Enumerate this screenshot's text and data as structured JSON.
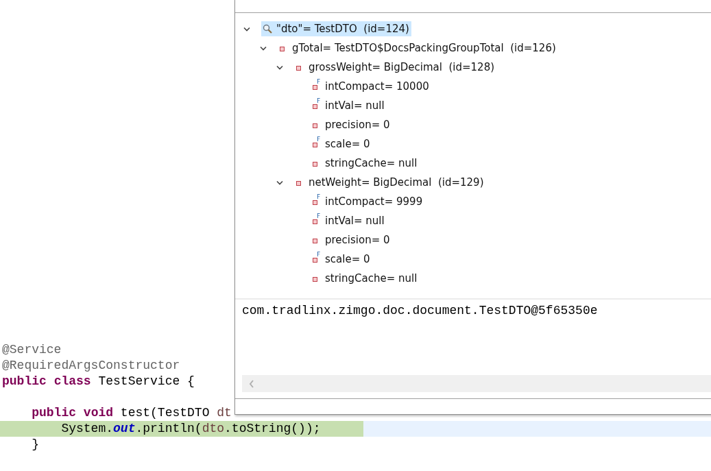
{
  "editor": {
    "lines": [
      {
        "current": false,
        "tokens": [
          {
            "kind": "annotation",
            "text": "@Service"
          }
        ]
      },
      {
        "current": false,
        "tokens": [
          {
            "kind": "annotation",
            "text": "@RequiredArgsConstructor"
          }
        ]
      },
      {
        "current": false,
        "tokens": [
          {
            "kind": "keyword",
            "text": "public "
          },
          {
            "kind": "keyword",
            "text": "class"
          },
          {
            "kind": "plain",
            "text": " TestService {"
          }
        ]
      },
      {
        "current": false
      },
      {
        "current": false,
        "tokens": [
          {
            "kind": "keyword",
            "text": "    public "
          },
          {
            "kind": "keyword",
            "text": "void"
          },
          {
            "kind": "plain",
            "text": " test(TestDTO "
          },
          {
            "kind": "param",
            "text": "dt"
          }
        ]
      },
      {
        "current": true,
        "tokens": [
          {
            "kind": "plain",
            "text": "        System."
          },
          {
            "kind": "static",
            "text": "out"
          },
          {
            "kind": "plain",
            "text": ".println("
          },
          {
            "kind": "param",
            "text": "dto"
          },
          {
            "kind": "plain",
            "text": ".toString());"
          }
        ]
      },
      {
        "current": false,
        "tokens": [
          {
            "kind": "plain",
            "text": "    }"
          }
        ]
      }
    ]
  },
  "inspector": {
    "tree": [
      {
        "kind": "expression",
        "text": "\"dto\"= TestDTO  (id=124)",
        "selected": true,
        "expanded": true,
        "children": [
          {
            "kind": "field",
            "text": "gTotal= TestDTO$DocsPackingGroupTotal  (id=126)",
            "selected": false,
            "expanded": true,
            "children": [
              {
                "kind": "field",
                "text": "grossWeight= BigDecimal  (id=128)",
                "selected": false,
                "expanded": true,
                "children": [
                  {
                    "kind": "field",
                    "modifier": "F",
                    "text": "intCompact= 10000",
                    "selected": false
                  },
                  {
                    "kind": "field",
                    "modifier": "F",
                    "text": "intVal= null",
                    "selected": false
                  },
                  {
                    "kind": "field",
                    "text": "precision= 0",
                    "selected": false
                  },
                  {
                    "kind": "field",
                    "modifier": "F",
                    "text": "scale= 0",
                    "selected": false
                  },
                  {
                    "kind": "field",
                    "text": "stringCache= null",
                    "selected": false
                  }
                ]
              },
              {
                "kind": "field",
                "text": "netWeight= BigDecimal  (id=129)",
                "selected": false,
                "expanded": true,
                "children": [
                  {
                    "kind": "field",
                    "modifier": "F",
                    "text": "intCompact= 9999",
                    "selected": false
                  },
                  {
                    "kind": "field",
                    "modifier": "F",
                    "text": "intVal= null",
                    "selected": false
                  },
                  {
                    "kind": "field",
                    "text": "precision= 0",
                    "selected": false
                  },
                  {
                    "kind": "field",
                    "modifier": "F",
                    "text": "scale= 0",
                    "selected": false
                  },
                  {
                    "kind": "field",
                    "text": "stringCache= null",
                    "selected": false
                  }
                ]
              }
            ]
          }
        ]
      }
    ],
    "detail": "com.tradlinx.zimgo.doc.document.TestDTO@5f65350e"
  }
}
